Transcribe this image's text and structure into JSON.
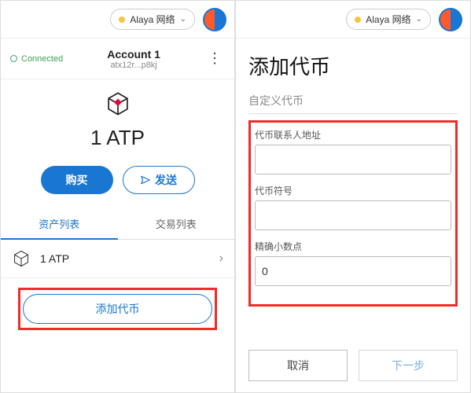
{
  "network": {
    "label": "Alaya 网络"
  },
  "left": {
    "connected": "Connected",
    "account": {
      "name": "Account 1",
      "addr": "atx12r...p8kj"
    },
    "balance": "1 ATP",
    "buy_label": "购买",
    "send_label": "发送",
    "tabs": {
      "assets": "资产列表",
      "tx": "交易列表"
    },
    "asset_item": "1 ATP",
    "add_token_label": "添加代币"
  },
  "right": {
    "title": "添加代币",
    "subtab": "自定义代币",
    "addr_label": "代币联系人地址",
    "symbol_label": "代币符号",
    "decimals_label": "精确小数点",
    "decimals_value": "0",
    "cancel": "取消",
    "next": "下一步"
  }
}
